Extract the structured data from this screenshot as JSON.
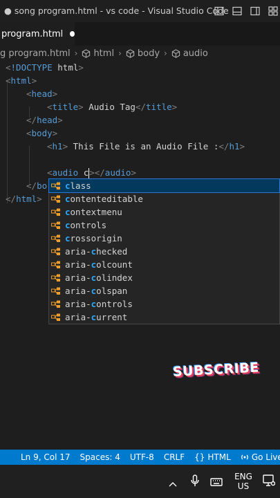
{
  "window": {
    "title": "● song program.html - vs code - Visual Studio Code"
  },
  "tab": {
    "label": "program.html"
  },
  "breadcrumb": {
    "file": "g program.html",
    "items": [
      "html",
      "body",
      "audio"
    ]
  },
  "editor": {
    "lines": [
      {
        "parts": [
          [
            "br",
            "<"
          ],
          [
            "tag",
            "!DOCTYPE "
          ],
          [
            "txt",
            "html"
          ],
          [
            "br",
            ">"
          ]
        ]
      },
      {
        "parts": [
          [
            "br",
            "<"
          ],
          [
            "tag",
            "html"
          ],
          [
            "br",
            ">"
          ]
        ]
      },
      {
        "parts": [
          [
            "br",
            "<"
          ],
          [
            "tag",
            "head"
          ],
          [
            "br",
            ">"
          ]
        ]
      },
      {
        "parts": [
          [
            "br",
            "<"
          ],
          [
            "tag",
            "title"
          ],
          [
            "br",
            ">"
          ],
          [
            "txt",
            " Audio Tag"
          ],
          [
            "br",
            "</"
          ],
          [
            "tag",
            "title"
          ],
          [
            "br",
            ">"
          ]
        ]
      },
      {
        "parts": [
          [
            "br",
            "</"
          ],
          [
            "tag",
            "head"
          ],
          [
            "br",
            ">"
          ]
        ]
      },
      {
        "parts": [
          [
            "br",
            "<"
          ],
          [
            "tag",
            "body"
          ],
          [
            "br",
            ">"
          ]
        ]
      },
      {
        "parts": [
          [
            "br",
            "<"
          ],
          [
            "tag",
            "h1"
          ],
          [
            "br",
            ">"
          ],
          [
            "txt",
            " This File is an Audio File :"
          ],
          [
            "br",
            "</"
          ],
          [
            "tag",
            "h1"
          ],
          [
            "br",
            ">"
          ]
        ]
      },
      {
        "parts": []
      },
      {
        "parts": [
          [
            "br",
            "<"
          ],
          [
            "tag",
            "audio "
          ],
          [
            "txt",
            "c"
          ]
        ],
        "cursor": true,
        "after": [
          [
            "br",
            "></"
          ],
          [
            "tag",
            "audio"
          ],
          [
            "br",
            ">"
          ]
        ]
      },
      {
        "parts": [
          [
            "br",
            "</"
          ],
          [
            "tag",
            "bo"
          ]
        ]
      },
      {
        "parts": [
          [
            "br",
            "</"
          ],
          [
            "tag",
            "html"
          ],
          [
            "br",
            ">"
          ]
        ]
      }
    ]
  },
  "suggestions": [
    {
      "label": "class",
      "match": "c",
      "rest": "lass",
      "pre": ""
    },
    {
      "label": "contenteditable",
      "match": "c",
      "rest": "ontenteditable",
      "pre": ""
    },
    {
      "label": "contextmenu",
      "match": "c",
      "rest": "ontextmenu",
      "pre": ""
    },
    {
      "label": "controls",
      "match": "c",
      "rest": "ontrols",
      "pre": ""
    },
    {
      "label": "crossorigin",
      "match": "c",
      "rest": "rossorigin",
      "pre": ""
    },
    {
      "label": "aria-checked",
      "pre": "aria-",
      "match": "c",
      "rest": "hecked"
    },
    {
      "label": "aria-colcount",
      "pre": "aria-",
      "match": "c",
      "rest": "olcount"
    },
    {
      "label": "aria-colindex",
      "pre": "aria-",
      "match": "c",
      "rest": "olindex"
    },
    {
      "label": "aria-colspan",
      "pre": "aria-",
      "match": "c",
      "rest": "olspan"
    },
    {
      "label": "aria-controls",
      "pre": "aria-",
      "match": "c",
      "rest": "ontrols"
    },
    {
      "label": "aria-current",
      "pre": "aria-",
      "match": "c",
      "rest": "urrent"
    }
  ],
  "watermark": {
    "text": "SUBSCRIBE"
  },
  "statusbar": {
    "position": "Ln 9, Col 17",
    "spaces": "Spaces: 4",
    "encoding": "UTF-8",
    "eol": "CRLF",
    "language": "HTML",
    "live": "Go Live"
  },
  "taskbar": {
    "lang_top": "ENG",
    "lang_bottom": "US"
  },
  "colors": {
    "accent": "#007acc",
    "tag": "#569cd6",
    "match": "#2aaaff",
    "selected": "#04395e"
  }
}
